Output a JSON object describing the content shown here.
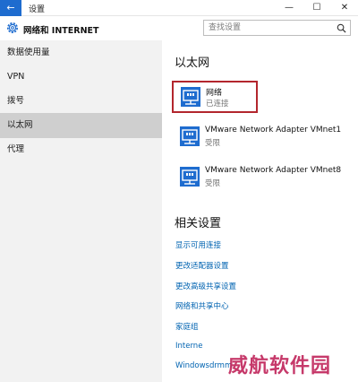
{
  "window": {
    "back_glyph": "←",
    "title": "设置",
    "min_glyph": "—",
    "max_glyph": "☐",
    "close_glyph": "✕"
  },
  "header": {
    "title": "网络和 INTERNET",
    "search_placeholder": "查找设置"
  },
  "sidebar": {
    "items": [
      {
        "label": "数据使用量"
      },
      {
        "label": "VPN"
      },
      {
        "label": "拨号"
      },
      {
        "label": "以太网",
        "active": true
      },
      {
        "label": "代理"
      }
    ]
  },
  "main": {
    "title": "以太网",
    "networks": [
      {
        "name": "网络",
        "status": "已连接"
      },
      {
        "name": "VMware Network Adapter VMnet1",
        "status": "受限"
      },
      {
        "name": "VMware Network Adapter VMnet8",
        "status": "受限"
      }
    ],
    "related_title": "相关设置",
    "related_links": [
      "显示可用连接",
      "更改适配器设置",
      "更改高级共享设置",
      "网络和共享中心",
      "家庭组",
      "Interne",
      "Windowsdrmm"
    ]
  },
  "watermark": "威航软件园",
  "colors": {
    "accent": "#1e6ccf",
    "link": "#0063b1",
    "highlight_border": "#b3262d",
    "sidebar_bg": "#f2f2f2",
    "sidebar_active": "#cfcfcf"
  }
}
